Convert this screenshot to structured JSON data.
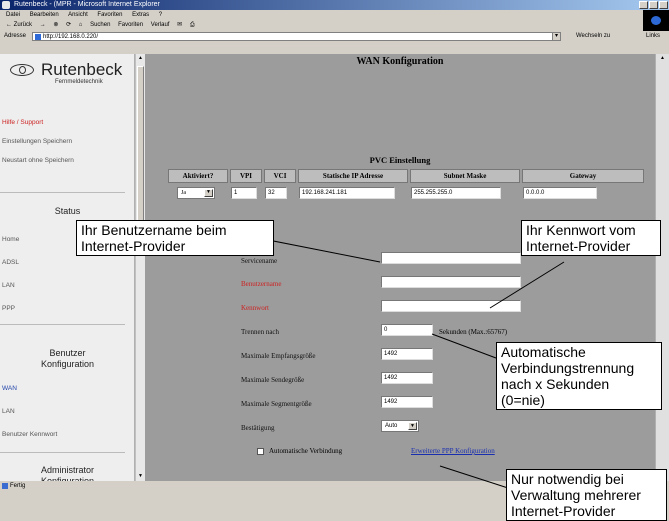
{
  "window": {
    "title": "Rutenbeck - (MPR - Microsoft Internet Explorer",
    "menu": [
      "Datei",
      "Bearbeiten",
      "Ansicht",
      "Favoriten",
      "Extras",
      "?"
    ],
    "toolbar": [
      "← Zurück",
      "→",
      "⊗",
      "⟳",
      "⌂",
      "Suchen",
      "Favoriten",
      "Verlauf",
      "✉",
      "⎙"
    ],
    "address_label": "Adresse",
    "address_value": "http://192.168.0.220/",
    "go_label": "Wechseln zu",
    "links_label": "Links",
    "status_text": "Fertig"
  },
  "sidebar": {
    "logo_name": "Rutenbeck",
    "logo_sub": "Fernmeldetechnik",
    "top_items": [
      "Hilfe / Support",
      "Einstellungen Speichern",
      "Neustart ohne Speichern"
    ],
    "status_heading": "Status",
    "status_items": [
      "Home",
      "ADSL",
      "LAN",
      "PPP"
    ],
    "user_heading_1": "Benutzer",
    "user_heading_2": "Konfiguration",
    "user_items": [
      "WAN",
      "LAN",
      "Benutzer Kennwort"
    ],
    "admin_heading_1": "Administrator",
    "admin_heading_2": "Konfiguration"
  },
  "main": {
    "title": "WAN Konfiguration",
    "pvc_title": "PVC Einstellung",
    "pvc_headers": [
      "Aktiviert?",
      "VPI",
      "VCI",
      "Statische IP Adresse",
      "Subnet Maske",
      "Gateway"
    ],
    "pvc_row": {
      "active": "Ja",
      "vpi": "1",
      "vci": "32",
      "ip": "192.168.241.181",
      "mask": "255.255.255.0",
      "gateway": "0.0.0.0"
    },
    "fields": {
      "service_label": "Servicename",
      "service_value": "",
      "user_label": "Benutzername",
      "user_value": "",
      "password_label": "Kennwort",
      "password_value": "",
      "disconnect_label": "Trennen nach",
      "disconnect_value": "0",
      "disconnect_unit": "Sekunden (Max.:65767)",
      "mru_label": "Maximale Empfangsgröße",
      "mru_value": "1492",
      "mtu_label": "Maximale Sendegröße",
      "mtu_value": "1492",
      "mss_label": "Maximale Segmentgröße",
      "mss_value": "1492",
      "auth_label": "Bestätigung",
      "auth_value": "Auto",
      "autoconnect_label": "Automatische Verbindung",
      "extended_link": "Erweiterte PPP Konfiguration"
    }
  },
  "callouts": {
    "username": "Ihr Benutzername beim Internet-Provider",
    "password": "Ihr Kennwort vom Internet-Provider",
    "disconnect": "Automatische Verbindungstrennung nach x Sekunden (0=nie)",
    "multiple": "Nur notwendig bei Verwaltung mehrerer Internet-Provider"
  }
}
